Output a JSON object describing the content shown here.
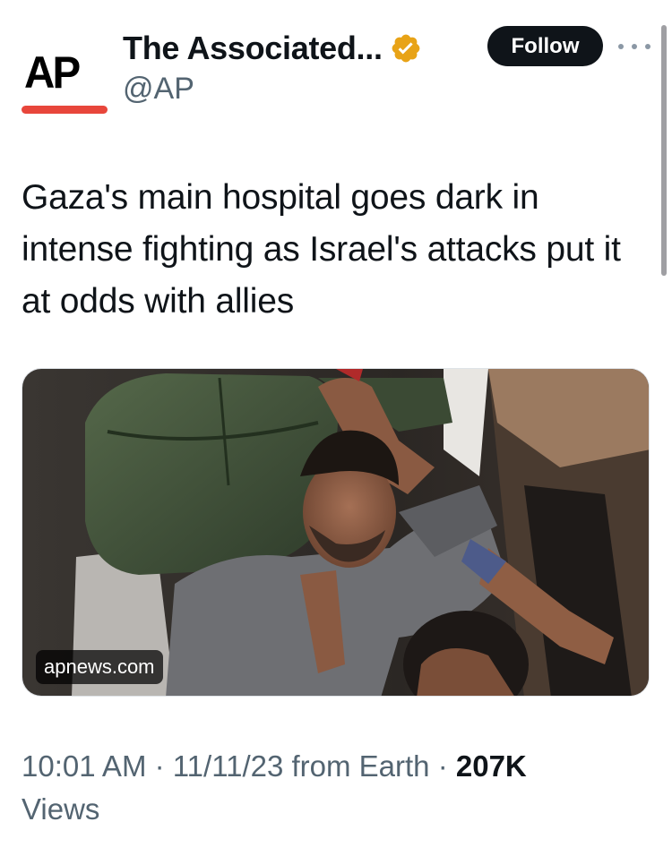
{
  "author": {
    "display_name": "The Associated...",
    "handle": "@AP",
    "avatar_text": "AP",
    "verified_icon": "verified-badge-icon",
    "verified_color": "#e8a317"
  },
  "actions": {
    "follow_label": "Follow",
    "more_icon": "more-options-icon"
  },
  "tweet": {
    "text": "Gaza's main hospital goes dark in intense fighting as Israel's attacks put it at odds with allies"
  },
  "link_card": {
    "domain": "apnews.com"
  },
  "meta": {
    "time": "10:01 AM",
    "separator": " · ",
    "date": "11/11/23",
    "source": " from Earth",
    "views_count": "207K",
    "views_label": "Views"
  },
  "colors": {
    "brand_red": "#e8463b",
    "text_primary": "#0f1419",
    "text_secondary": "#536471",
    "button_bg": "#0f1419"
  }
}
